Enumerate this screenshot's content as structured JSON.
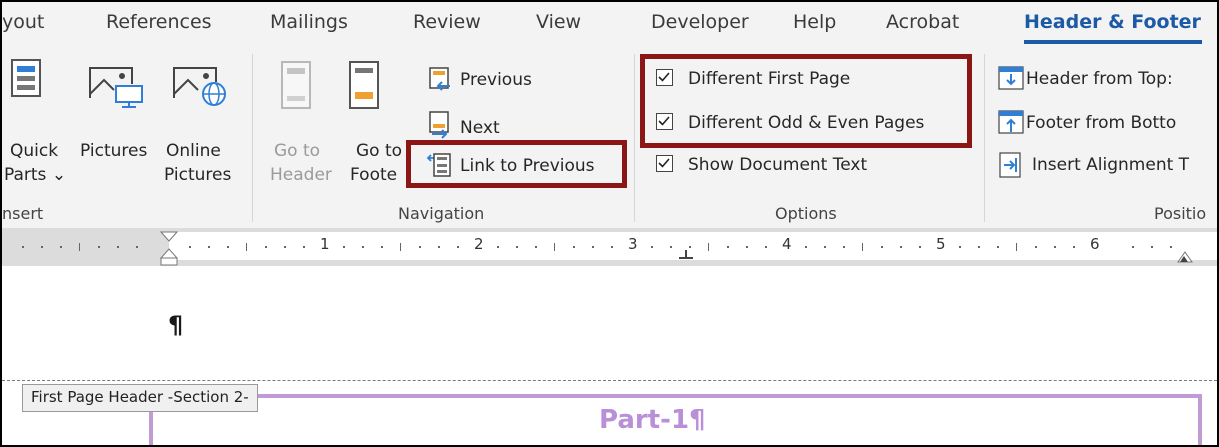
{
  "tabs": [
    {
      "label": "yout"
    },
    {
      "label": "References"
    },
    {
      "label": "Mailings"
    },
    {
      "label": "Review"
    },
    {
      "label": "View"
    },
    {
      "label": "Developer"
    },
    {
      "label": "Help"
    },
    {
      "label": "Acrobat"
    },
    {
      "label": "Header & Footer",
      "active": true
    }
  ],
  "insert_group": {
    "quick_parts_line1": "Quick",
    "quick_parts_line2": "Parts ⌄",
    "pictures": "Pictures",
    "online_pictures_line1": "Online",
    "online_pictures_line2": "Pictures",
    "group_label": "nsert"
  },
  "navigation_group": {
    "go_to_header_line1": "Go to",
    "go_to_header_line2": "Header",
    "go_to_footer_line1": "Go to",
    "go_to_footer_line2": "Foote",
    "previous": "Previous",
    "next": "Next",
    "link_to_previous": "Link to Previous",
    "group_label": "Navigation"
  },
  "options_group": {
    "different_first_page": "Different First Page",
    "different_first_page_checked": true,
    "different_odd_even": "Different Odd & Even Pages",
    "different_odd_even_checked": true,
    "show_document_text": "Show Document Text",
    "show_document_text_checked": true,
    "group_label": "Options"
  },
  "position_group": {
    "header_from_top": "Header from Top:",
    "footer_from_bottom": "Footer from Botto",
    "insert_alignment_tab": "Insert Alignment T",
    "group_label": "Positio"
  },
  "ruler": {
    "numbers": [
      "1",
      "2",
      "3",
      "4",
      "5",
      "6"
    ]
  },
  "document": {
    "pilcrow": "¶",
    "header_tag": "First Page Header -Section 2-",
    "header_text": "Part-1¶"
  },
  "colors": {
    "accent": "#1d5aa6",
    "highlight_box": "#8b1616",
    "header_border": "#c09bd6",
    "header_text": "#b98fd8"
  }
}
